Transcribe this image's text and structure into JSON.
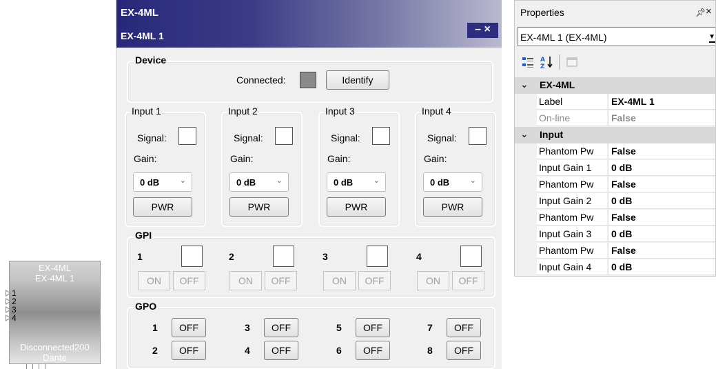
{
  "block": {
    "title": "EX-4ML",
    "label": "EX-4ML 1",
    "pins": [
      "1",
      "2",
      "3",
      "4"
    ],
    "status": "Disconnected200",
    "type": "Dante"
  },
  "device_window": {
    "title": "EX-4ML",
    "subtitle": "EX-4ML 1",
    "controls": "– ×",
    "device_group": {
      "label": "Device",
      "connected_label": "Connected:",
      "identify_label": "Identify"
    },
    "inputs": [
      {
        "label": "Input 1",
        "signal": "Signal:",
        "gain": "Gain:",
        "gain_value": "0 dB",
        "pwr": "PWR"
      },
      {
        "label": "Input 2",
        "signal": "Signal:",
        "gain": "Gain:",
        "gain_value": "0 dB",
        "pwr": "PWR"
      },
      {
        "label": "Input 3",
        "signal": "Signal:",
        "gain": "Gain:",
        "gain_value": "0 dB",
        "pwr": "PWR"
      },
      {
        "label": "Input 4",
        "signal": "Signal:",
        "gain": "Gain:",
        "gain_value": "0 dB",
        "pwr": "PWR"
      }
    ],
    "gpi": {
      "label": "GPI",
      "channels": [
        {
          "num": "1",
          "on": "ON",
          "off": "OFF"
        },
        {
          "num": "2",
          "on": "ON",
          "off": "OFF"
        },
        {
          "num": "3",
          "on": "ON",
          "off": "OFF"
        },
        {
          "num": "4",
          "on": "ON",
          "off": "OFF"
        }
      ]
    },
    "gpo": {
      "label": "GPO",
      "channels": [
        {
          "num": "1",
          "state": "OFF"
        },
        {
          "num": "2",
          "state": "OFF"
        },
        {
          "num": "3",
          "state": "OFF"
        },
        {
          "num": "4",
          "state": "OFF"
        },
        {
          "num": "5",
          "state": "OFF"
        },
        {
          "num": "6",
          "state": "OFF"
        },
        {
          "num": "7",
          "state": "OFF"
        },
        {
          "num": "8",
          "state": "OFF"
        }
      ]
    }
  },
  "properties": {
    "title": "Properties",
    "pin_icon": "pin-icon",
    "close_icon": "close-icon",
    "selected_object": "EX-4ML 1 (EX-4ML)",
    "toolbar": [
      "categorized-icon",
      "alphabetical-sort-icon",
      "property-pages-icon"
    ],
    "categories": [
      {
        "name": "EX-4ML",
        "rows": [
          {
            "name": "Label",
            "value_a": "EX-4ML ",
            "value_b": "1",
            "dim": false
          },
          {
            "name": "On-line",
            "value_a": "False",
            "value_b": "",
            "dim": true
          }
        ]
      },
      {
        "name": "Input",
        "rows": [
          {
            "name": "Phantom Pw",
            "value_a": "False",
            "value_b": "",
            "dim": false
          },
          {
            "name": "Input Gain 1",
            "value_a": "0 dB",
            "value_b": "",
            "dim": false
          },
          {
            "name": "Phantom Pw",
            "value_a": "False",
            "value_b": "",
            "dim": false
          },
          {
            "name": "Input Gain 2",
            "value_a": "0 dB",
            "value_b": "",
            "dim": false
          },
          {
            "name": "Phantom Pw",
            "value_a": "False",
            "value_b": "",
            "dim": false
          },
          {
            "name": "Input Gain 3",
            "value_a": "0 dB",
            "value_b": "",
            "dim": false
          },
          {
            "name": "Phantom Pw",
            "value_a": "False",
            "value_b": "",
            "dim": false
          },
          {
            "name": "Input Gain 4",
            "value_a": "0 dB",
            "value_b": "",
            "dim": false
          }
        ]
      }
    ]
  }
}
